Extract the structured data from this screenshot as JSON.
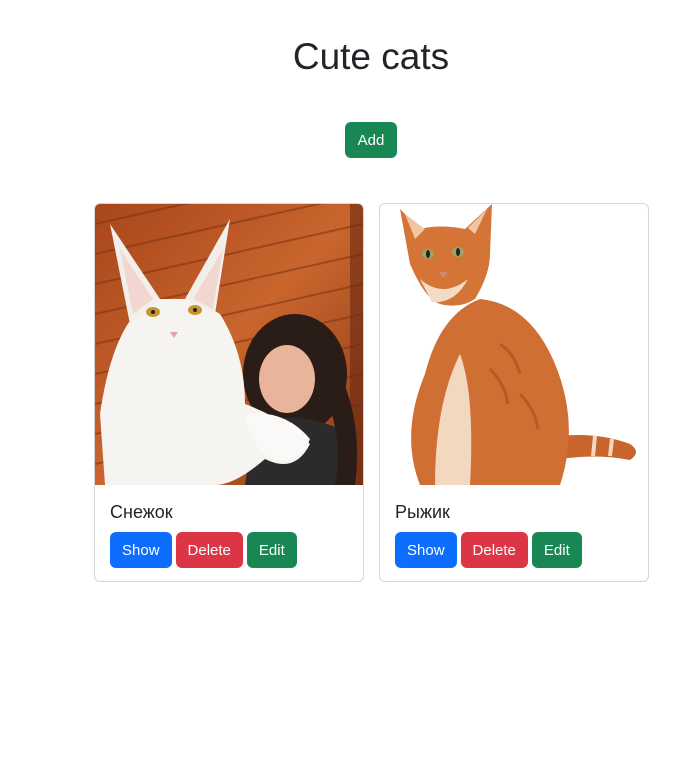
{
  "page": {
    "title": "Cute cats",
    "add_label": "Add"
  },
  "colors": {
    "primary": "#0d6efd",
    "danger": "#dc3545",
    "success": "#198754",
    "text": "#212529",
    "card_border": "#d3d6d9"
  },
  "cards": [
    {
      "name": "Снежок",
      "image": "white-maine-coon-cat-photo",
      "buttons": {
        "show": "Show",
        "delete": "Delete",
        "edit": "Edit"
      }
    },
    {
      "name": "Рыжик",
      "image": "orange-tabby-cat-photo",
      "buttons": {
        "show": "Show",
        "delete": "Delete",
        "edit": "Edit"
      }
    }
  ]
}
